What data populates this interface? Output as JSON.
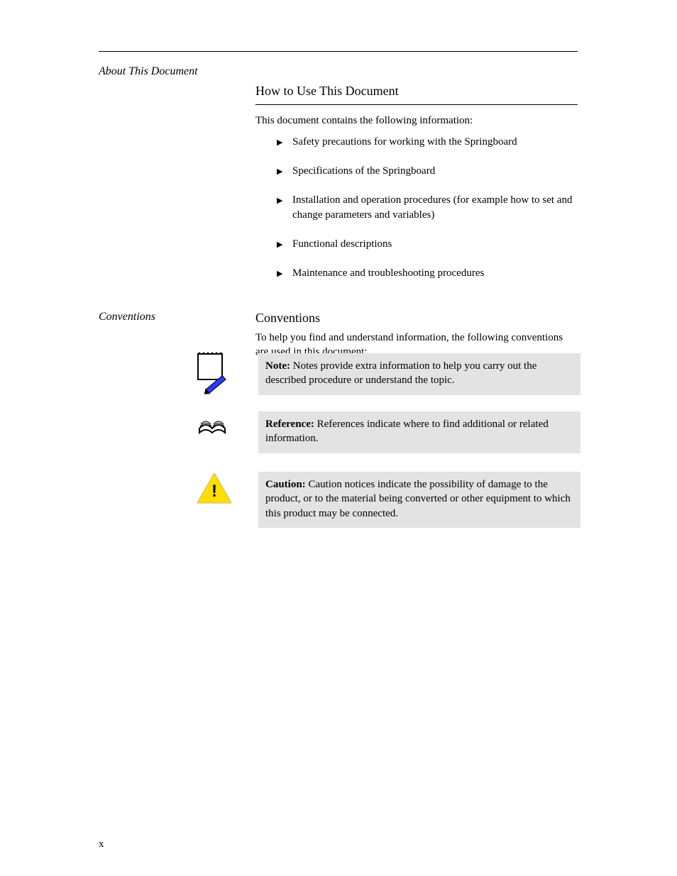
{
  "header": {
    "sidebar_top": "About This Document"
  },
  "section": {
    "title": "How to Use This Document",
    "intro": "This document contains the following information:",
    "bullets": [
      "Safety precautions for working with the Springboard",
      "Specifications of the Springboard",
      "Installation and operation procedures (for example how to set and change parameters and variables)",
      "Functional descriptions",
      "Maintenance and troubleshooting procedures"
    ]
  },
  "conventions": {
    "sidebar_label": "Conventions",
    "title": "Conventions",
    "intro": "To help you find and understand information, the following conventions are used in this document:",
    "note": {
      "label": "Note: ",
      "text": "Notes provide extra information to help you carry out the described procedure or understand the topic."
    },
    "ref": {
      "label": "Reference: ",
      "text": "References indicate where to find additional or related information."
    },
    "caution": {
      "label": "Caution: ",
      "text": "Caution notices indicate the possibility of damage to the product, or to the material being converted or other equipment to which this product may be connected."
    }
  },
  "icons": {
    "bullet_triangle": "▶",
    "note": "note-icon",
    "reference": "book-icon",
    "caution": "caution-icon"
  },
  "footer": {
    "page_number": "x"
  }
}
